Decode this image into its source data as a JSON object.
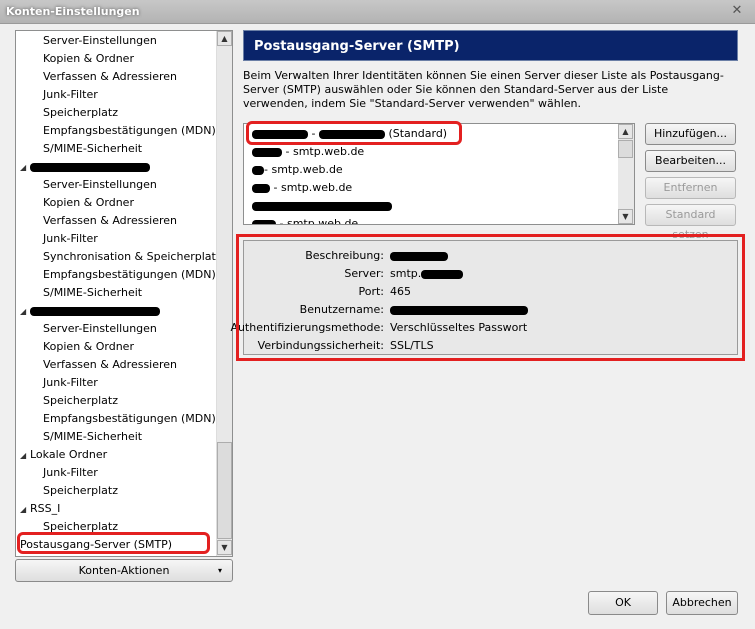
{
  "window": {
    "title": "Konten-Einstellungen",
    "close_glyph": "✕"
  },
  "sidebar": {
    "items": [
      {
        "label": "Server-Einstellungen",
        "level": "child"
      },
      {
        "label": "Kopien & Ordner",
        "level": "child"
      },
      {
        "label": "Verfassen & Adressieren",
        "level": "child"
      },
      {
        "label": "Junk-Filter",
        "level": "child"
      },
      {
        "label": "Speicherplatz",
        "level": "child"
      },
      {
        "label": "Empfangsbestätigungen (MDN)",
        "level": "child"
      },
      {
        "label": "S/MIME-Sicherheit",
        "level": "child"
      },
      {
        "label": "",
        "level": "account",
        "redacted": true
      },
      {
        "label": "Server-Einstellungen",
        "level": "child"
      },
      {
        "label": "Kopien & Ordner",
        "level": "child"
      },
      {
        "label": "Verfassen & Adressieren",
        "level": "child"
      },
      {
        "label": "Junk-Filter",
        "level": "child"
      },
      {
        "label": "Synchronisation & Speicherplatz",
        "level": "child"
      },
      {
        "label": "Empfangsbestätigungen (MDN)",
        "level": "child"
      },
      {
        "label": "S/MIME-Sicherheit",
        "level": "child"
      },
      {
        "label": "",
        "level": "account",
        "redacted": true
      },
      {
        "label": "Server-Einstellungen",
        "level": "child"
      },
      {
        "label": "Kopien & Ordner",
        "level": "child"
      },
      {
        "label": "Verfassen & Adressieren",
        "level": "child"
      },
      {
        "label": "Junk-Filter",
        "level": "child"
      },
      {
        "label": "Speicherplatz",
        "level": "child"
      },
      {
        "label": "Empfangsbestätigungen (MDN)",
        "level": "child"
      },
      {
        "label": "S/MIME-Sicherheit",
        "level": "child"
      },
      {
        "label": "Lokale Ordner",
        "level": "account"
      },
      {
        "label": "Junk-Filter",
        "level": "child"
      },
      {
        "label": "Speicherplatz",
        "level": "child"
      },
      {
        "label": "RSS_I",
        "level": "account"
      },
      {
        "label": "Speicherplatz",
        "level": "child"
      },
      {
        "label": "Postausgang-Server (SMTP)",
        "level": "selected"
      }
    ],
    "actions_button": "Konten-Aktionen"
  },
  "content": {
    "header": "Postausgang-Server (SMTP)",
    "description": "Beim Verwalten Ihrer Identitäten können Sie einen Server dieser Liste als Postausgang-Server (SMTP) auswählen oder Sie können den Standard-Server aus der Liste verwenden, indem Sie \"Standard-Server verwenden\" wählen.",
    "servers": [
      {
        "label": " - ",
        "suffix": " (Standard)",
        "redact_a": 56,
        "redact_b": 66
      },
      {
        "label": " - smtp.web.de",
        "suffix": "",
        "redact_a": 30,
        "redact_b": 0
      },
      {
        "label": "- smtp.web.de",
        "suffix": "",
        "redact_a": 12,
        "redact_b": 0
      },
      {
        "label": " - smtp.web.de",
        "suffix": "",
        "redact_a": 18,
        "redact_b": 0
      },
      {
        "label": "",
        "suffix": "",
        "redact_a": 140,
        "redact_b": 0
      },
      {
        "label": " - smtp.web.de",
        "suffix": "",
        "redact_a": 24,
        "redact_b": 0
      }
    ],
    "buttons": {
      "add": "Hinzufügen...",
      "edit": "Bearbeiten...",
      "remove": "Entfernen",
      "set_default": "Standard setzen"
    },
    "details": {
      "description_label": "Beschreibung:",
      "server_label": "Server:",
      "server_value": "smtp.",
      "port_label": "Port:",
      "port_value": "465",
      "username_label": "Benutzername:",
      "auth_label": "Authentifizierungsmethode:",
      "auth_value": "Verschlüsseltes Passwort",
      "security_label": "Verbindungssicherheit:",
      "security_value": "SSL/TLS"
    }
  },
  "footer": {
    "ok": "OK",
    "cancel": "Abbrechen"
  },
  "colors": {
    "header_bg": "#0a246a",
    "highlight": "#e32020"
  }
}
